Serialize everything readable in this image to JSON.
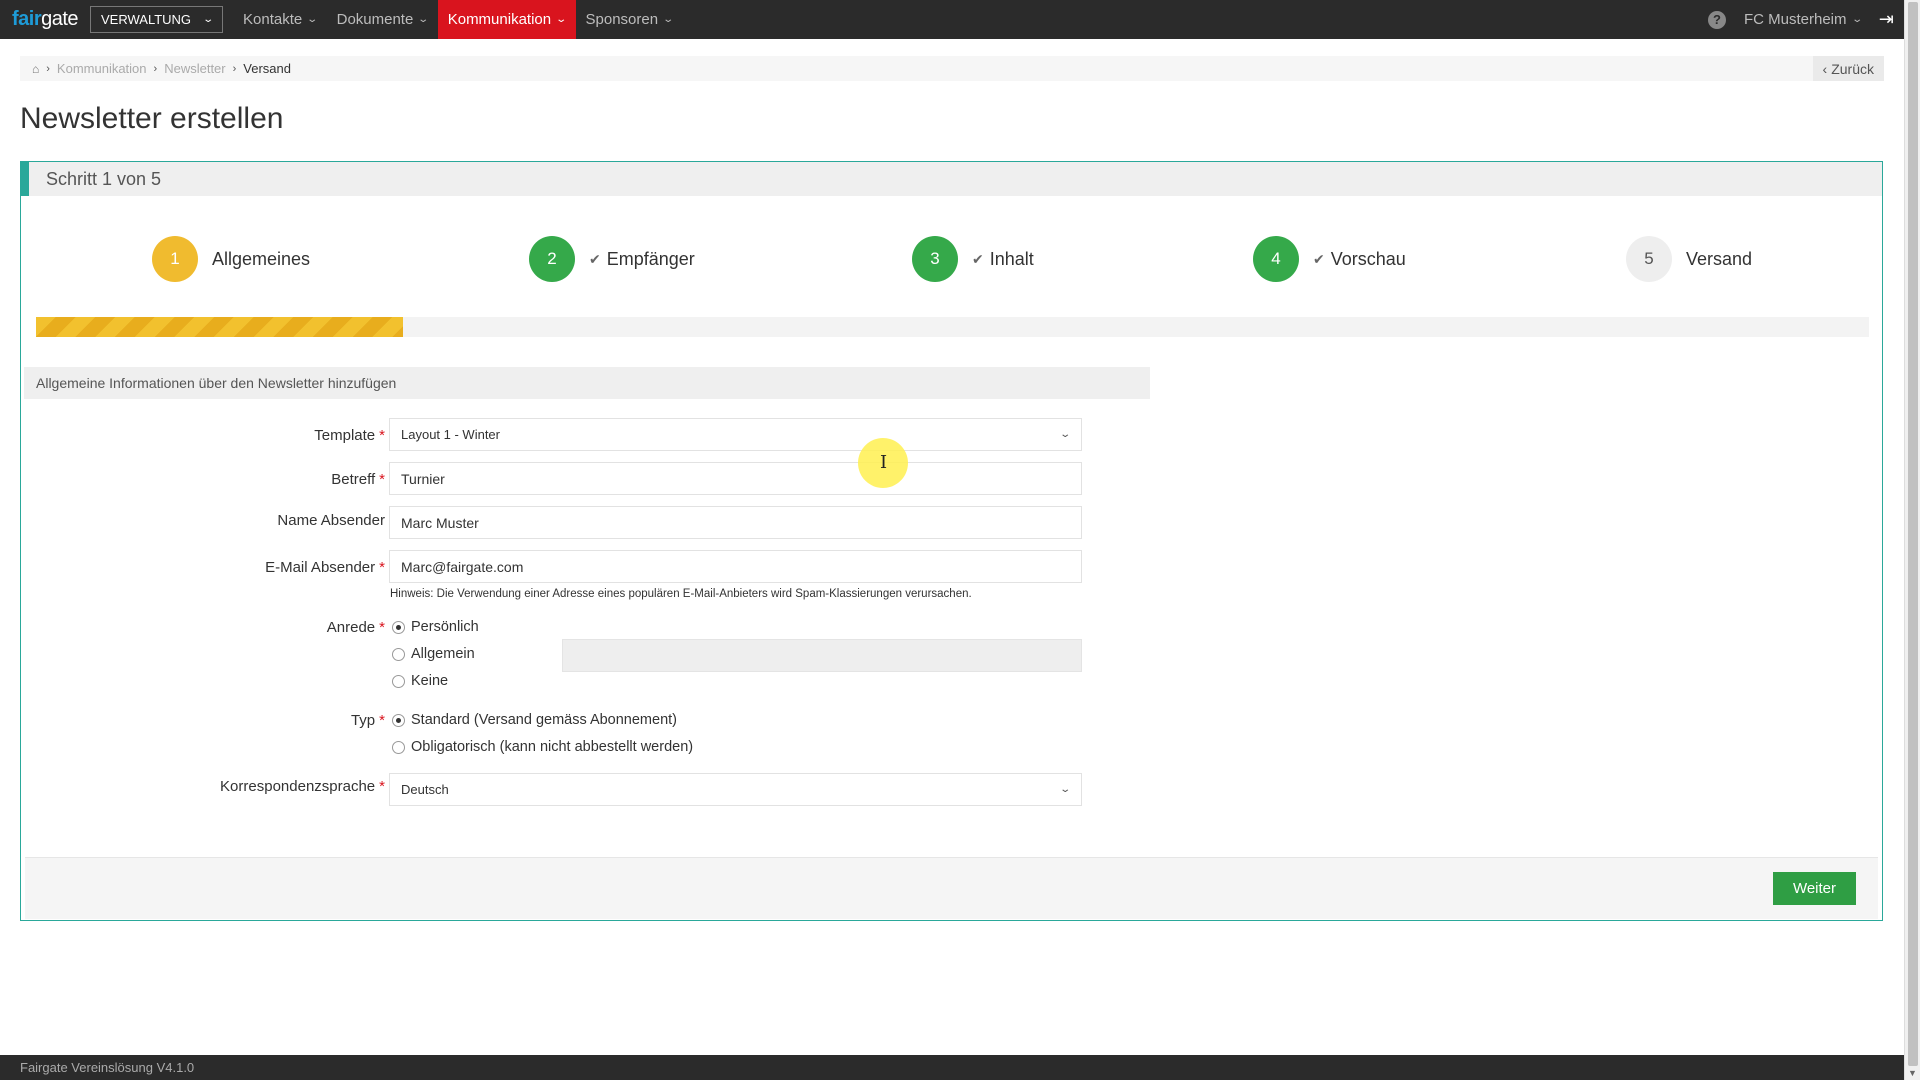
{
  "app": {
    "logo_fair": "fair",
    "logo_gate": "gate",
    "module_select": "VERWALTUNG",
    "nav": [
      {
        "label": "Kontakte"
      },
      {
        "label": "Dokumente"
      },
      {
        "label": "Kommunikation",
        "active": true
      },
      {
        "label": "Sponsoren"
      }
    ],
    "club": "FC Musterheim",
    "help_icon": "question-circle-icon",
    "logout_icon": "sign-out-icon"
  },
  "breadcrumb": {
    "items": [
      "Kommunikation",
      "Newsletter",
      "Versand"
    ],
    "back_label": "Zurück"
  },
  "page": {
    "title": "Newsletter erstellen",
    "step_header": "Schritt 1 von 5"
  },
  "steps": [
    {
      "number": "1",
      "label": "Allgemeines",
      "state": "current",
      "color": "#f0bb2f"
    },
    {
      "number": "2",
      "label": "Empfänger",
      "state": "done",
      "color": "#35a94a"
    },
    {
      "number": "3",
      "label": "Inhalt",
      "state": "done",
      "color": "#35a94a"
    },
    {
      "number": "4",
      "label": "Vorschau",
      "state": "done",
      "color": "#35a94a"
    },
    {
      "number": "5",
      "label": "Versand",
      "state": "todo",
      "color": "#eeeeee"
    }
  ],
  "progress": {
    "completed_fraction": 0.2
  },
  "form": {
    "section_title": "Allgemeine Informationen über den Newsletter hinzufügen",
    "template": {
      "label": "Template",
      "value": "Layout 1 - Winter"
    },
    "betreff": {
      "label": "Betreff",
      "value": "Turnier"
    },
    "name_absender": {
      "label": "Name Absender",
      "value": "Marc Muster"
    },
    "email_absender": {
      "label": "E-Mail Absender",
      "value": "Marc@fairgate.com",
      "hint": "Hinweis: Die Verwendung einer Adresse eines populären E-Mail-Anbieters wird Spam-Klassierungen verursachen."
    },
    "anrede": {
      "label": "Anrede",
      "options": [
        "Persönlich",
        "Allgemein",
        "Keine"
      ],
      "selected": "Persönlich"
    },
    "typ": {
      "label": "Typ",
      "options": [
        "Standard (Versand gemäss Abonnement)",
        "Obligatorisch (kann nicht abbestellt werden)"
      ],
      "selected": "Standard (Versand gemäss Abonnement)"
    },
    "sprache": {
      "label": "Korrespondenzsprache",
      "value": "Deutsch"
    }
  },
  "actions": {
    "next_label": "Weiter"
  },
  "footer": {
    "text": "Fairgate Vereinslösung V4.1.0"
  },
  "colors": {
    "accent": "#2aa89a",
    "active_nav": "#d9141e",
    "success": "#2f9e44"
  }
}
